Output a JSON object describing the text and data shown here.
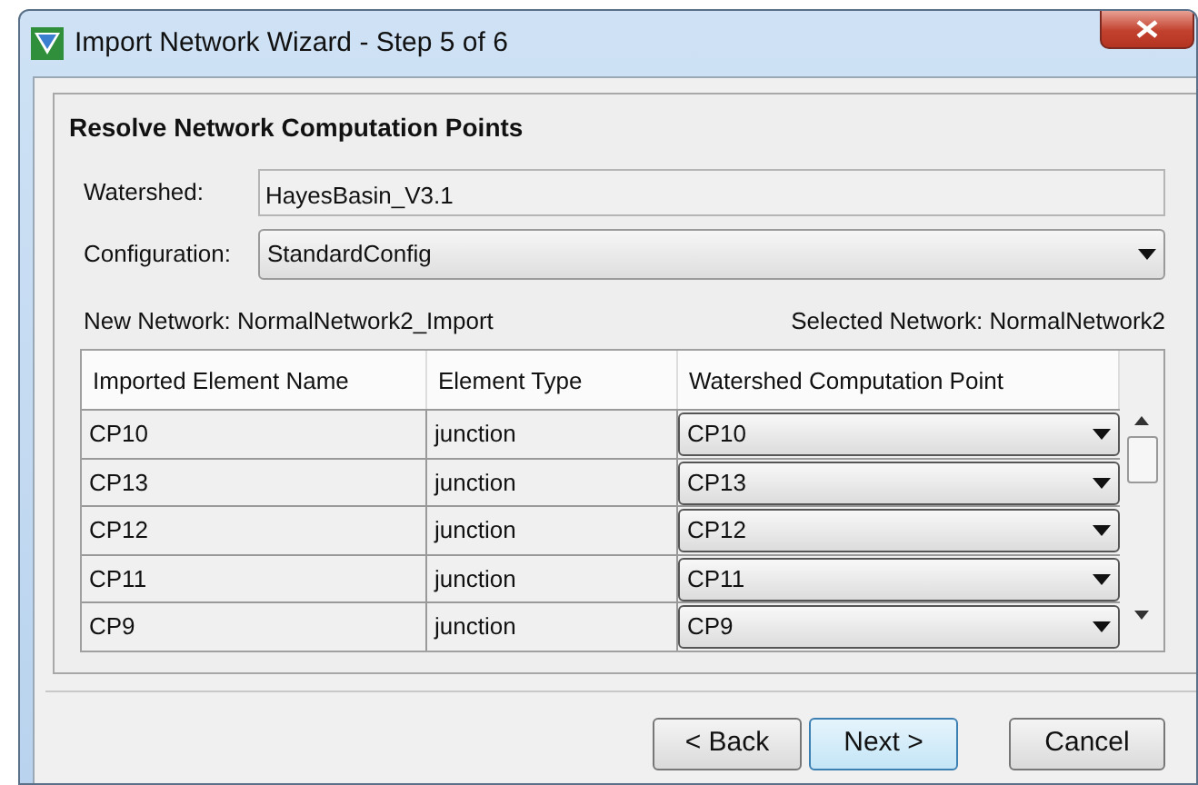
{
  "window": {
    "title": "Import Network Wizard - Step 5 of 6"
  },
  "heading": "Resolve Network Computation Points",
  "watershed": {
    "label": "Watershed:",
    "value": "HayesBasin_V3.1"
  },
  "configuration": {
    "label": "Configuration:",
    "value": "StandardConfig"
  },
  "new_network": "New Network: NormalNetwork2_Import",
  "selected_network": "Selected Network: NormalNetwork2",
  "table": {
    "columns": [
      "Imported Element Name",
      "Element Type",
      "Watershed Computation Point"
    ],
    "rows": [
      {
        "name": "CP10",
        "type": "junction",
        "point": "CP10"
      },
      {
        "name": "CP13",
        "type": "junction",
        "point": "CP13"
      },
      {
        "name": "CP12",
        "type": "junction",
        "point": "CP12"
      },
      {
        "name": "CP11",
        "type": "junction",
        "point": "CP11"
      },
      {
        "name": "CP9",
        "type": "junction",
        "point": "CP9"
      }
    ]
  },
  "buttons": [
    {
      "label": "< Back",
      "default": false
    },
    {
      "label": "Next >",
      "default": true
    },
    {
      "label": "Cancel",
      "default": false
    }
  ]
}
